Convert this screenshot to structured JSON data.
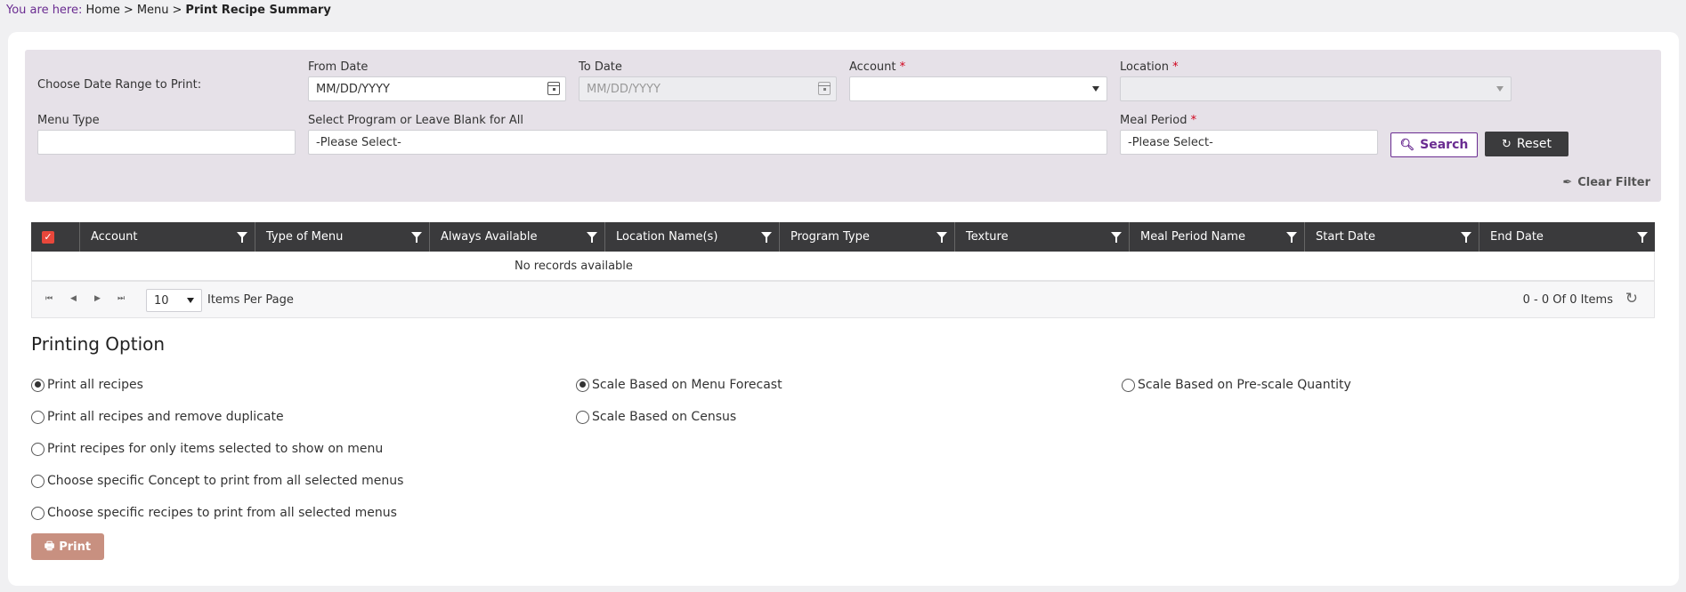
{
  "breadcrumb": {
    "lead": "You are here:",
    "items": [
      "Home",
      "Menu"
    ],
    "current": "Print Recipe Summary"
  },
  "filter": {
    "date_range_label": "Choose Date Range to Print:",
    "from_date": {
      "label": "From Date",
      "placeholder": "MM/DD/YYYY"
    },
    "to_date": {
      "label": "To Date",
      "placeholder": "MM/DD/YYYY"
    },
    "account": {
      "label": "Account",
      "required": "*",
      "value": ""
    },
    "location": {
      "label": "Location",
      "required": "*",
      "value": ""
    },
    "menu_type": {
      "label": "Menu Type",
      "value": ""
    },
    "program": {
      "label": "Select Program or Leave Blank for All",
      "value": "-Please Select-"
    },
    "meal_period": {
      "label": "Meal Period",
      "required": "*",
      "value": "-Please Select-"
    },
    "search_label": "Search",
    "reset_label": "Reset",
    "clear_filter_label": "Clear Filter"
  },
  "grid": {
    "columns": [
      "Account",
      "Type of Menu",
      "Always Available",
      "Location Name(s)",
      "Program Type",
      "Texture",
      "Meal Period Name",
      "Start Date",
      "End Date"
    ],
    "empty_text": "No records available",
    "page_size": "10",
    "items_per_page_label": "Items Per Page",
    "count_text": "0 - 0 Of 0 Items"
  },
  "printing": {
    "title": "Printing Option",
    "options_left": [
      {
        "label": "Print all recipes",
        "checked": true
      },
      {
        "label": "Print all recipes and remove duplicate",
        "checked": false
      },
      {
        "label": "Print recipes for only items selected to show on menu",
        "checked": false
      },
      {
        "label": "Choose specific Concept to print from all selected menus",
        "checked": false
      },
      {
        "label": "Choose specific recipes to print from all selected menus",
        "checked": false
      }
    ],
    "options_scale": [
      {
        "label": "Scale Based on Menu Forecast",
        "checked": true
      },
      {
        "label": "Scale Based on Census",
        "checked": false
      },
      {
        "label": "Scale Based on Pre-scale Quantity",
        "checked": false
      }
    ],
    "print_label": "Print"
  },
  "colors": {
    "accent": "#6a2c91",
    "header": "#3a3a3c",
    "filter_bg": "#e6e1e8",
    "print_button": "#c89080",
    "checkbox": "#e8473b"
  }
}
